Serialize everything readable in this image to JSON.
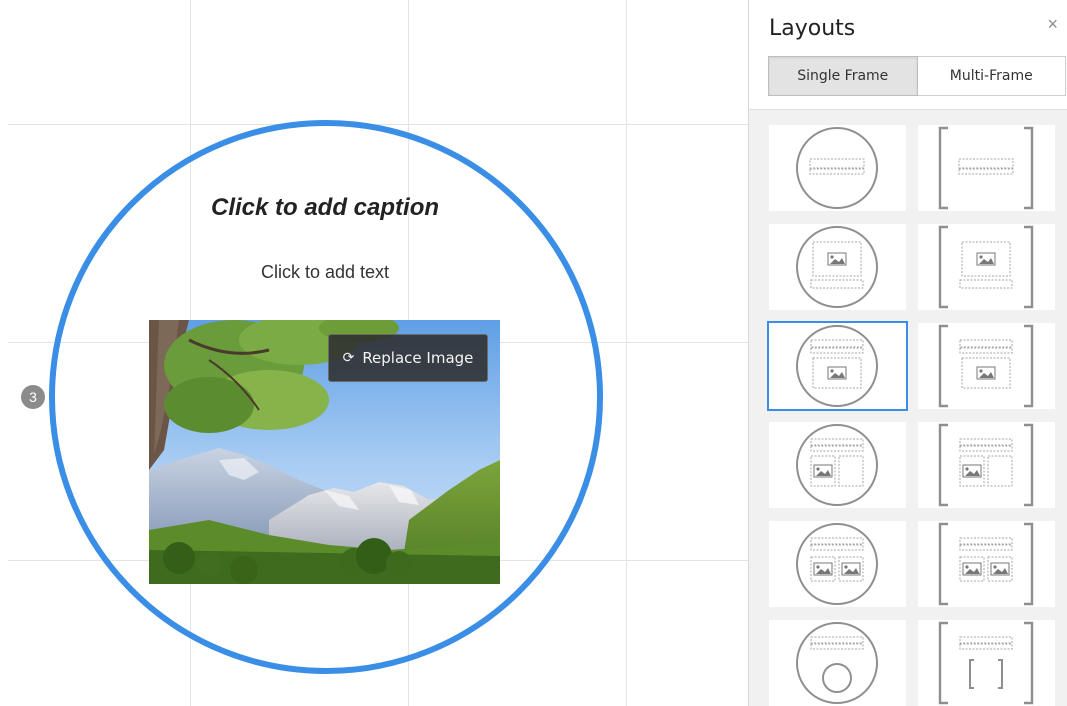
{
  "canvas": {
    "caption_placeholder": "Click to add caption",
    "text_placeholder": "Click to add text",
    "replace_image_label": "Replace Image",
    "replace_image_icon": "refresh-icon",
    "page_number": "3",
    "frame_color": "#3a8ee6"
  },
  "panel": {
    "title": "Layouts",
    "close_icon": "×",
    "tabs": [
      {
        "label": "Single Frame",
        "active": true
      },
      {
        "label": "Multi-Frame",
        "active": false
      }
    ],
    "layouts": [
      {
        "frame": "circle",
        "content": "text",
        "selected": false
      },
      {
        "frame": "bracket",
        "content": "text",
        "selected": false
      },
      {
        "frame": "circle",
        "content": "image-caption",
        "selected": false
      },
      {
        "frame": "bracket",
        "content": "image-caption",
        "selected": false
      },
      {
        "frame": "circle",
        "content": "caption-image",
        "selected": true
      },
      {
        "frame": "bracket",
        "content": "caption-image",
        "selected": false
      },
      {
        "frame": "circle",
        "content": "caption-image-text",
        "selected": false
      },
      {
        "frame": "bracket",
        "content": "caption-image-text",
        "selected": false
      },
      {
        "frame": "circle",
        "content": "caption-two-images",
        "selected": false
      },
      {
        "frame": "bracket",
        "content": "caption-two-images",
        "selected": false
      },
      {
        "frame": "circle",
        "content": "caption-circle",
        "selected": false
      },
      {
        "frame": "bracket",
        "content": "caption-bracket",
        "selected": false
      }
    ]
  }
}
